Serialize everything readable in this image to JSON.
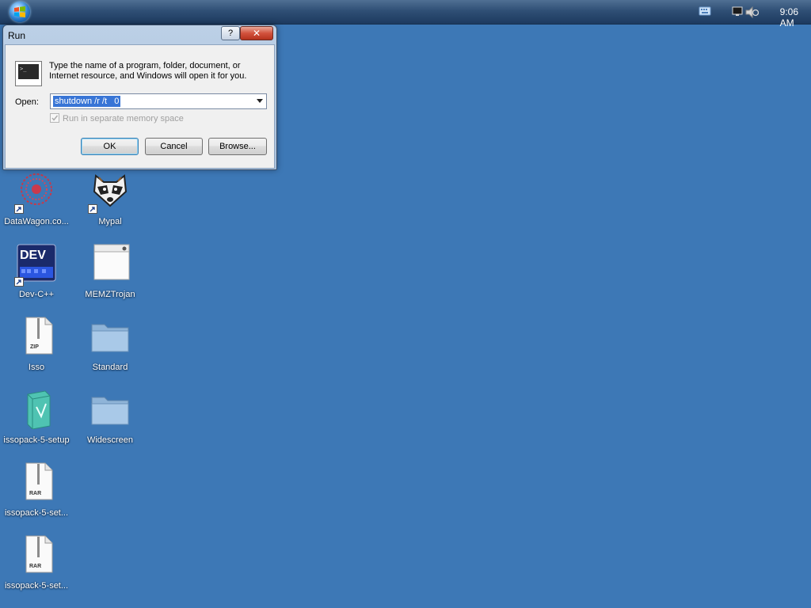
{
  "taskbar": {
    "clock": "9:06 AM",
    "tray_icons": [
      "keyboard-icon",
      "monitor-icon",
      "speaker-icon"
    ]
  },
  "dialog": {
    "title": "Run",
    "help_label": "?",
    "close_label": "✕",
    "description": "Type the name of a program, folder, document, or Internet resource, and Windows will open it for you.",
    "open_label": "Open:",
    "open_value": "shutdown /r /t   0",
    "checkbox_label": "Run in separate memory space",
    "buttons": {
      "ok": "OK",
      "cancel": "Cancel",
      "browse": "Browse..."
    }
  },
  "desktop": {
    "icons": [
      {
        "label": "DataWagon.co...",
        "icon": "datawagon-icon"
      },
      {
        "label": "Mypal",
        "icon": "raccoon-icon"
      },
      {
        "label": "Dev-C++",
        "icon": "devcpp-icon",
        "badge": "DEV"
      },
      {
        "label": "MEMZTrojan",
        "icon": "window-app-icon"
      },
      {
        "label": "Isso",
        "icon": "zip-file-icon",
        "badge": "ZIP"
      },
      {
        "label": "Standard",
        "icon": "folder-icon"
      },
      {
        "label": "issopack-5-setup",
        "icon": "installer-icon"
      },
      {
        "label": "Widescreen",
        "icon": "folder-icon"
      },
      {
        "label": "issopack-5-set...",
        "icon": "rar-file-icon",
        "badge": "RAR"
      },
      {
        "label": "issopack-5-set...",
        "icon": "rar-file-icon",
        "badge": "RAR"
      }
    ]
  },
  "colors": {
    "desktop": "#3d78b6",
    "taskbar": "#2f4f75",
    "selection": "#3875d6"
  }
}
